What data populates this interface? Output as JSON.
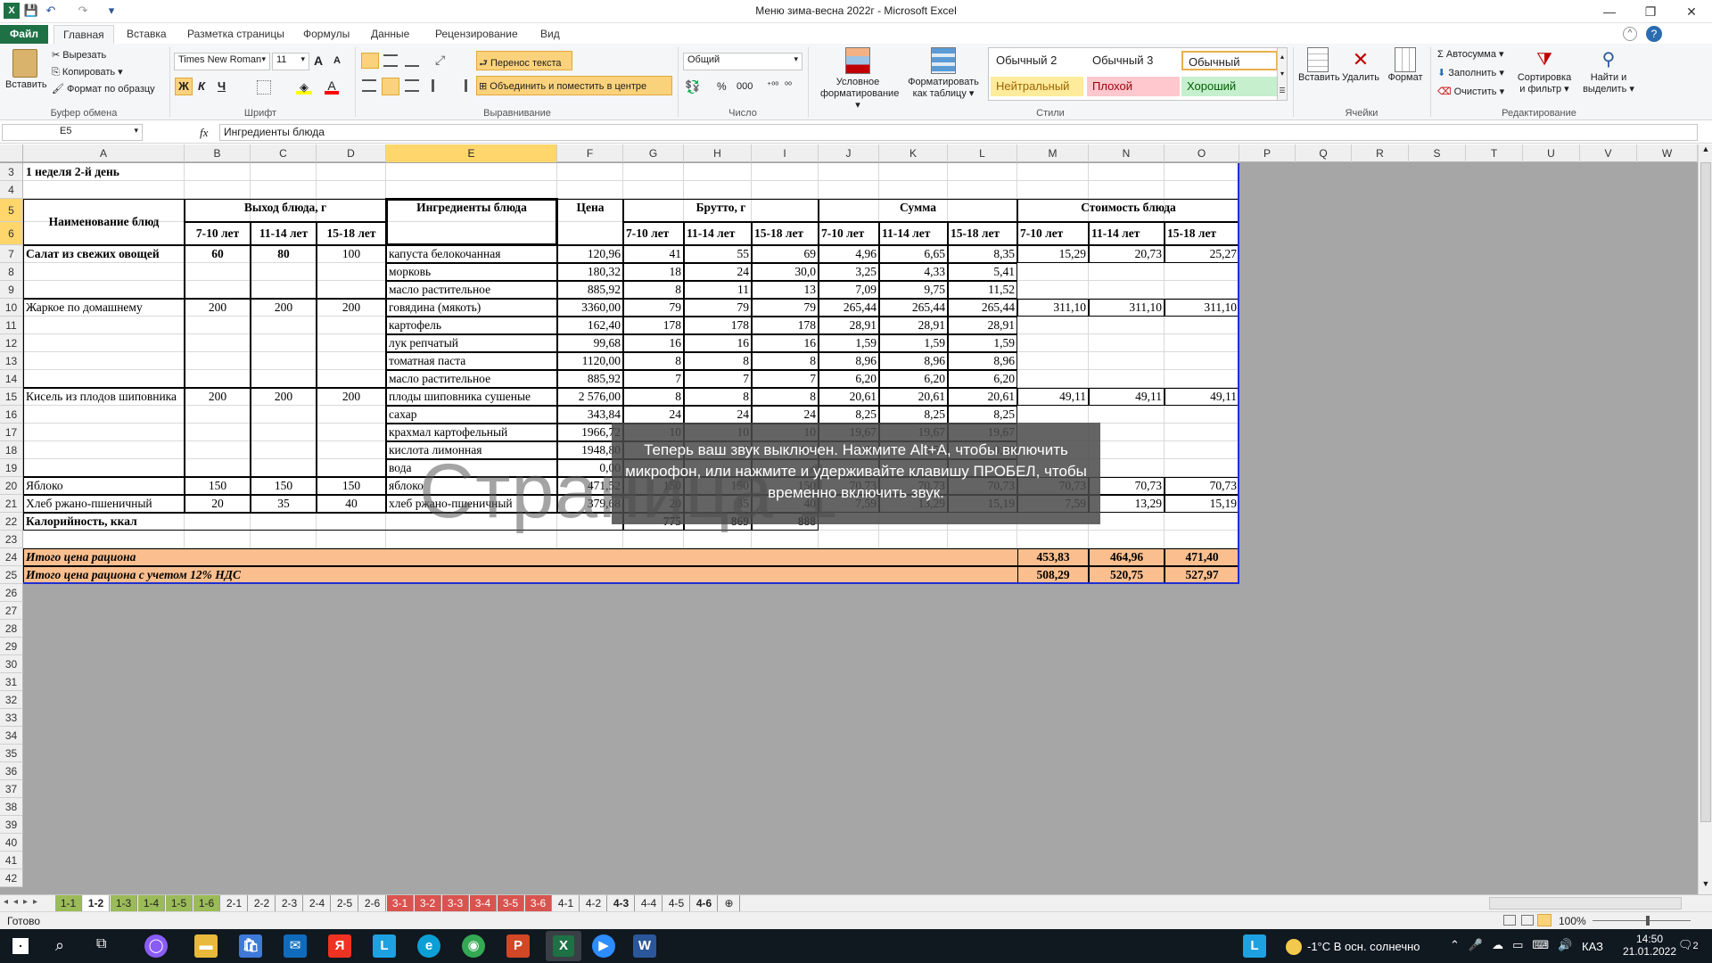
{
  "window": {
    "title": "Меню зима-весна 2022г  -  Microsoft Excel",
    "minimize": "—",
    "restore": "❐",
    "close": "✕"
  },
  "qat": {
    "save": "💾",
    "undo": "↶",
    "redo": "↷",
    "more": "▾"
  },
  "ribbon_tabs": [
    {
      "label": "Файл"
    },
    {
      "label": "Главная"
    },
    {
      "label": "Вставка"
    },
    {
      "label": "Разметка страницы"
    },
    {
      "label": "Формулы"
    },
    {
      "label": "Данные"
    },
    {
      "label": "Рецензирование"
    },
    {
      "label": "Вид"
    }
  ],
  "ribbon": {
    "clipboard": {
      "paste": "Вставить",
      "cut": "Вырезать",
      "copy": "Копировать ▾",
      "format_painter": "Формат по образцу",
      "label": "Буфер обмена"
    },
    "font": {
      "name": "Times New Roman",
      "size": "11",
      "bold": "Ж",
      "italic": "К",
      "underline": "Ч",
      "grow": "A",
      "shrink": "A",
      "label": "Шрифт"
    },
    "alignment": {
      "wrap": "Перенос текста",
      "merge": "Объединить и поместить в центре",
      "label": "Выравнивание"
    },
    "number": {
      "format": "Общий",
      "percent": "%",
      "thousands": "000",
      "label": "Число"
    },
    "styles": {
      "conditional": "Условное форматирование ▾",
      "as_table": "Форматировать как таблицу ▾",
      "cells": [
        "Обычный 2",
        "Обычный 3",
        "Обычный",
        "Нейтральный",
        "Плохой",
        "Хороший"
      ],
      "label": "Стили"
    },
    "cells_group": {
      "insert": "Вставить",
      "delete": "Удалить",
      "format": "Формат",
      "label": "Ячейки"
    },
    "editing": {
      "autosum": "Σ Автосумма ▾",
      "fill": "Заполнить ▾",
      "clear": "Очистить ▾",
      "sort": "Сортировка и фильтр ▾",
      "find": "Найти и выделить ▾",
      "label": "Редактирование"
    }
  },
  "formula_bar": {
    "name_box": "E5",
    "fx": "fx",
    "value": "Ингредиенты блюда"
  },
  "columns": [
    "A",
    "B",
    "C",
    "D",
    "E",
    "F",
    "G",
    "H",
    "I",
    "J",
    "K",
    "L",
    "M",
    "N",
    "O",
    "P",
    "Q",
    "R",
    "S",
    "T",
    "U",
    "V",
    "W"
  ],
  "rows": [
    "3",
    "4",
    "5",
    "6",
    "7",
    "8",
    "9",
    "10",
    "11",
    "12",
    "13",
    "14",
    "15",
    "16",
    "17",
    "18",
    "19",
    "20",
    "21",
    "22",
    "23",
    "24",
    "25",
    "26",
    "27",
    "28",
    "29",
    "30",
    "31",
    "32",
    "33",
    "34",
    "35",
    "36",
    "37",
    "38",
    "39",
    "40",
    "41",
    "42"
  ],
  "table": {
    "week_title": "1 неделя 2-й день",
    "h_name": "Наименование блюд",
    "h_output": "Выход блюда, г",
    "h_ingredients": "Ингредиенты блюда",
    "h_price": "Цена",
    "h_gross": "Брутто, г",
    "h_sum": "Сумма",
    "h_cost": "Стоимость блюда",
    "age1": "7-10 лет",
    "age2": "11-14 лет",
    "age3": "15-18 лет",
    "dishes": [
      {
        "name": "Салат из свежих овощей",
        "out": [
          "60",
          "80",
          "100"
        ],
        "cost": [
          "15,29",
          "20,73",
          "25,27"
        ]
      },
      {
        "name": "Жаркое по домашнему",
        "out": [
          "200",
          "200",
          "200"
        ],
        "cost": [
          "311,10",
          "311,10",
          "311,10"
        ]
      },
      {
        "name": "Кисель из плодов шиповника",
        "out": [
          "200",
          "200",
          "200"
        ],
        "cost": [
          "49,11",
          "49,11",
          "49,11"
        ]
      },
      {
        "name": "Яблоко",
        "out": [
          "150",
          "150",
          "150"
        ],
        "cost": [
          "70,73",
          "70,73",
          "70,73"
        ]
      },
      {
        "name": "Хлеб ржано-пшеничный",
        "out": [
          "20",
          "35",
          "40"
        ],
        "cost": [
          "7,59",
          "13,29",
          "15,19"
        ]
      }
    ],
    "ingredients": [
      {
        "n": "капуста белокочанная",
        "p": "120,96",
        "g": [
          "41",
          "55",
          "69"
        ],
        "s": [
          "4,96",
          "6,65",
          "8,35"
        ]
      },
      {
        "n": "морковь",
        "p": "180,32",
        "g": [
          "18",
          "24",
          "30,0"
        ],
        "s": [
          "3,25",
          "4,33",
          "5,41"
        ]
      },
      {
        "n": "масло растительное",
        "p": "885,92",
        "g": [
          "8",
          "11",
          "13"
        ],
        "s": [
          "7,09",
          "9,75",
          "11,52"
        ]
      },
      {
        "n": "говядина (мякоть)",
        "p": "3360,00",
        "g": [
          "79",
          "79",
          "79"
        ],
        "s": [
          "265,44",
          "265,44",
          "265,44"
        ]
      },
      {
        "n": "картофель",
        "p": "162,40",
        "g": [
          "178",
          "178",
          "178"
        ],
        "s": [
          "28,91",
          "28,91",
          "28,91"
        ]
      },
      {
        "n": "лук репчатый",
        "p": "99,68",
        "g": [
          "16",
          "16",
          "16"
        ],
        "s": [
          "1,59",
          "1,59",
          "1,59"
        ]
      },
      {
        "n": "томатная паста",
        "p": "1120,00",
        "g": [
          "8",
          "8",
          "8"
        ],
        "s": [
          "8,96",
          "8,96",
          "8,96"
        ]
      },
      {
        "n": "масло растительное",
        "p": "885,92",
        "g": [
          "7",
          "7",
          "7"
        ],
        "s": [
          "6,20",
          "6,20",
          "6,20"
        ]
      },
      {
        "n": "плоды шиповника сушеные",
        "p": "2 576,00",
        "g": [
          "8",
          "8",
          "8"
        ],
        "s": [
          "20,61",
          "20,61",
          "20,61"
        ]
      },
      {
        "n": "сахар",
        "p": "343,84",
        "g": [
          "24",
          "24",
          "24"
        ],
        "s": [
          "8,25",
          "8,25",
          "8,25"
        ]
      },
      {
        "n": "крахмал картофельный",
        "p": "1966,72",
        "g": [
          "10",
          "10",
          "10"
        ],
        "s": [
          "19,67",
          "19,67",
          "19,67"
        ]
      },
      {
        "n": "кислота лимонная",
        "p": "1948,80",
        "g": [
          "0,3",
          "0,3",
          "0,3"
        ],
        "s": [
          "0,58",
          "0,58",
          "0,58"
        ]
      },
      {
        "n": "вода",
        "p": "0,00",
        "g": [
          "",
          "",
          ""
        ],
        "s": [
          "",
          "",
          ""
        ]
      },
      {
        "n": "яблоко",
        "p": "471,52",
        "g": [
          "150",
          "150",
          "150"
        ],
        "s": [
          "70,73",
          "70,73",
          "70,73"
        ]
      },
      {
        "n": "хлеб ржано-пшеничный",
        "p": "379,68",
        "g": [
          "20",
          "35",
          "40"
        ],
        "s": [
          "7,59",
          "13,29",
          "15,19"
        ]
      }
    ],
    "calories_label": "Калорийность, ккал",
    "calories": [
      "775",
      "869",
      "888"
    ],
    "total_label": "Итого цена рациона",
    "total": [
      "453,83",
      "464,96",
      "471,40"
    ],
    "total_vat_label": "Итого цена рациона с учетом 12% НДС",
    "total_vat": [
      "508,29",
      "520,75",
      "527,97"
    ]
  },
  "watermark": "Страница 1",
  "toast": "Теперь ваш звук выключен. Нажмите Alt+A, чтобы включить микрофон, или нажмите и удерживайте клавишу ПРОБЕЛ, чтобы временно включить звук.",
  "sheet_tabs": [
    "1-1",
    "1-2",
    "1-3",
    "1-4",
    "1-5",
    "1-6",
    "2-1",
    "2-2",
    "2-3",
    "2-4",
    "2-5",
    "2-6",
    "3-1",
    "3-2",
    "3-3",
    "3-4",
    "3-5",
    "3-6",
    "4-1",
    "4-2",
    "4-3",
    "4-4",
    "4-5",
    "4-6"
  ],
  "colors": {
    "green_tab": "#9bbb59",
    "red_tab": "#d9534f",
    "peach_total": "#fbbf8f",
    "accent": "#1e7145",
    "selection": "#ffd66c"
  },
  "status": {
    "ready": "Готово",
    "zoom": "100%"
  },
  "taskbar": {
    "weather": "-1°C  В осн. солнечно",
    "lang": "КАЗ",
    "time": "14:50",
    "date": "21.01.2022",
    "notifications": "2"
  }
}
